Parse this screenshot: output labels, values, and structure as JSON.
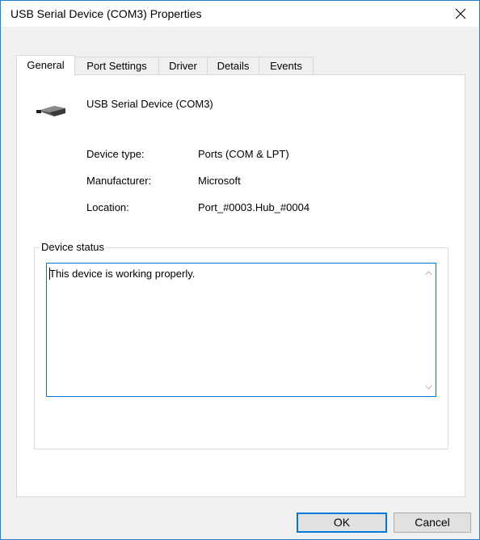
{
  "window": {
    "title": "USB Serial Device (COM3) Properties",
    "close_glyph": "✕"
  },
  "tabs": [
    {
      "label": "General",
      "active": true
    },
    {
      "label": "Port Settings",
      "active": false
    },
    {
      "label": "Driver",
      "active": false
    },
    {
      "label": "Details",
      "active": false
    },
    {
      "label": "Events",
      "active": false
    }
  ],
  "general": {
    "device_icon": "serial-connector-icon",
    "device_name": "USB Serial Device (COM3)",
    "properties": [
      {
        "label": "Device type:",
        "value": "Ports (COM & LPT)"
      },
      {
        "label": "Manufacturer:",
        "value": "Microsoft"
      },
      {
        "label": "Location:",
        "value": "Port_#0003.Hub_#0004"
      }
    ],
    "status_group_label": "Device status",
    "status_text": "This device is working properly."
  },
  "buttons": {
    "ok_label": "OK",
    "cancel_label": "Cancel"
  },
  "colors": {
    "window_border": "#1883d7",
    "focus_accent": "#0078d7",
    "dialog_background": "#f0f0f0"
  }
}
